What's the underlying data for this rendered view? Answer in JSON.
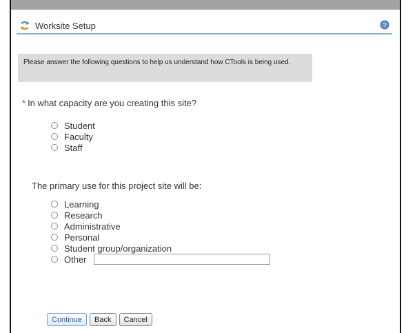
{
  "header": {
    "title": "Worksite Setup",
    "tool_icon": "worksite-setup-icon",
    "help_icon": "help-icon"
  },
  "instructions": "Please answer the following questions to help us understand how CTools is being used.",
  "q1": {
    "required_mark": "*",
    "label": "In what capacity are you creating this site?",
    "options": [
      "Student",
      "Faculty",
      "Staff"
    ]
  },
  "q2": {
    "label": "The primary use for this project site will be:",
    "options": [
      "Learning",
      "Research",
      "Administrative",
      "Personal",
      "Student group/organization",
      "Other"
    ],
    "other_value": ""
  },
  "buttons": {
    "continue": "Continue",
    "back": "Back",
    "cancel": "Cancel"
  },
  "colors": {
    "required": "#cc2a1f",
    "header_rule": "#7fb1c7",
    "instructions_bg": "#dcdcdc"
  }
}
